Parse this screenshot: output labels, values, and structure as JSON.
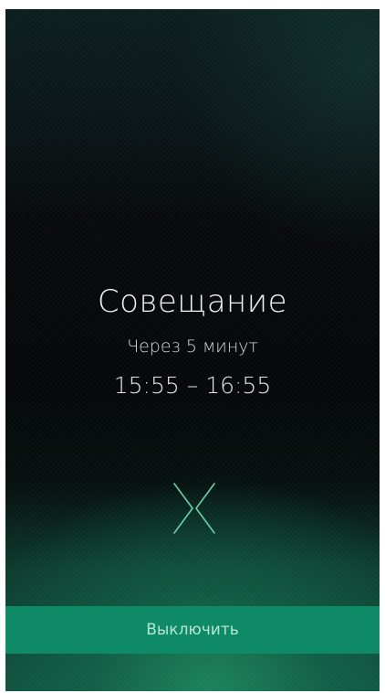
{
  "alarm": {
    "title": "Совещание",
    "subtitle": "Через 5 минут",
    "time_range": "15:55 – 16:55"
  },
  "controls": {
    "swipe_icon": "chevrons-converge-icon",
    "dismiss_label": "Выключить"
  },
  "colors": {
    "accent": "#0e8a66",
    "handle": "#5fd3b0"
  }
}
